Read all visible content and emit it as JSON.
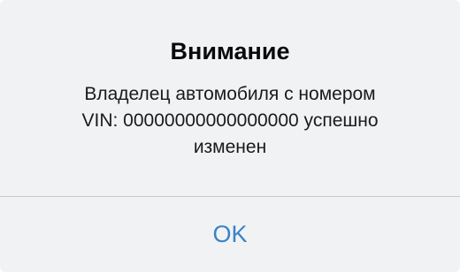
{
  "alert": {
    "title": "Внимание",
    "message_lines": [
      "Владелец автомобиля с номером",
      "VIN: 00000000000000000 успешно",
      "изменен"
    ],
    "ok_label": "OK"
  },
  "colors": {
    "background": "#f1f2f4",
    "divider": "#c8c9cc",
    "button_text": "#3a82c8",
    "title_text": "#0a0a0a"
  }
}
